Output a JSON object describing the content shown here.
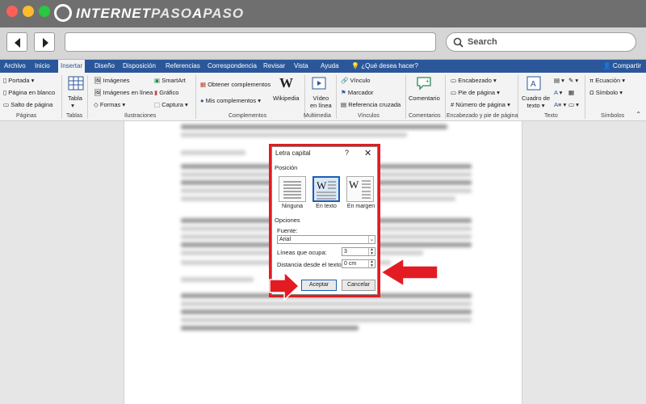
{
  "brand": {
    "logo_text_1": "INTERNET",
    "logo_text_2": "PASO",
    "logo_text_3": "A",
    "logo_text_4": "PASO"
  },
  "browser": {
    "search_label": "Search"
  },
  "tabs": [
    {
      "label": "Archivo"
    },
    {
      "label": "Inicio"
    },
    {
      "label": "Insertar"
    },
    {
      "label": "Diseño"
    },
    {
      "label": "Disposición"
    },
    {
      "label": "Referencias"
    },
    {
      "label": "Correspondencia"
    },
    {
      "label": "Revisar"
    },
    {
      "label": "Vista"
    },
    {
      "label": "Ayuda"
    },
    {
      "label": "¿Qué desea hacer?"
    }
  ],
  "share_label": "Compartir",
  "ribbon": {
    "paginas": {
      "portada": "Portada",
      "pagina_blanco": "Página en blanco",
      "salto": "Salto de página",
      "label": "Páginas"
    },
    "tablas": {
      "tabla": "Tabla",
      "label": "Tablas"
    },
    "ilustraciones": {
      "imagenes": "Imágenes",
      "imagenes_linea": "Imágenes en línea",
      "formas": "Formas",
      "smartart": "SmartArt",
      "grafico": "Gráfico",
      "captura": "Captura",
      "label": "Ilustraciones"
    },
    "complementos": {
      "obtener": "Obtener complementos",
      "mis": "Mis complementos",
      "wikipedia": "Wikipedia",
      "label": "Complementos"
    },
    "multimedia": {
      "video": "Vídeo",
      "en_linea": "en línea",
      "label": "Multimedia"
    },
    "vinculos": {
      "vinculo": "Vínculo",
      "marcador": "Marcador",
      "referencia": "Referencia cruzada",
      "label": "Vínculos"
    },
    "comentarios": {
      "comentario": "Comentario",
      "label": "Comentarios"
    },
    "encabezado": {
      "encabezado": "Encabezado",
      "pie": "Pie de página",
      "numero": "Número de página",
      "label": "Encabezado y pie de página"
    },
    "texto": {
      "cuadro": "Cuadro de",
      "texto_word": "texto",
      "label": "Texto"
    },
    "simbolos": {
      "ecuacion": "Ecuación",
      "simbolo": "Símbolo",
      "label": "Símbolos"
    }
  },
  "dialog": {
    "title": "Letra capital",
    "help": "?",
    "close": "✕",
    "posicion_label": "Posición",
    "options": [
      {
        "label": "Ninguna",
        "selected": false
      },
      {
        "label": "En texto",
        "selected": true
      },
      {
        "label": "En margen",
        "selected": false
      }
    ],
    "opciones_label": "Opciones",
    "fuente_label": "Fuente:",
    "fuente_value": "Arial",
    "lineas_label": "Líneas que ocupa:",
    "lineas_value": "3",
    "distancia_label": "Distancia desde el texto:",
    "distancia_value": "0 cm",
    "accept": "Aceptar",
    "cancel": "Cancelar"
  },
  "colors": {
    "ribbon_blue": "#2b579a",
    "highlight_red": "#e31b23",
    "arrow_red": "#e31b23"
  }
}
